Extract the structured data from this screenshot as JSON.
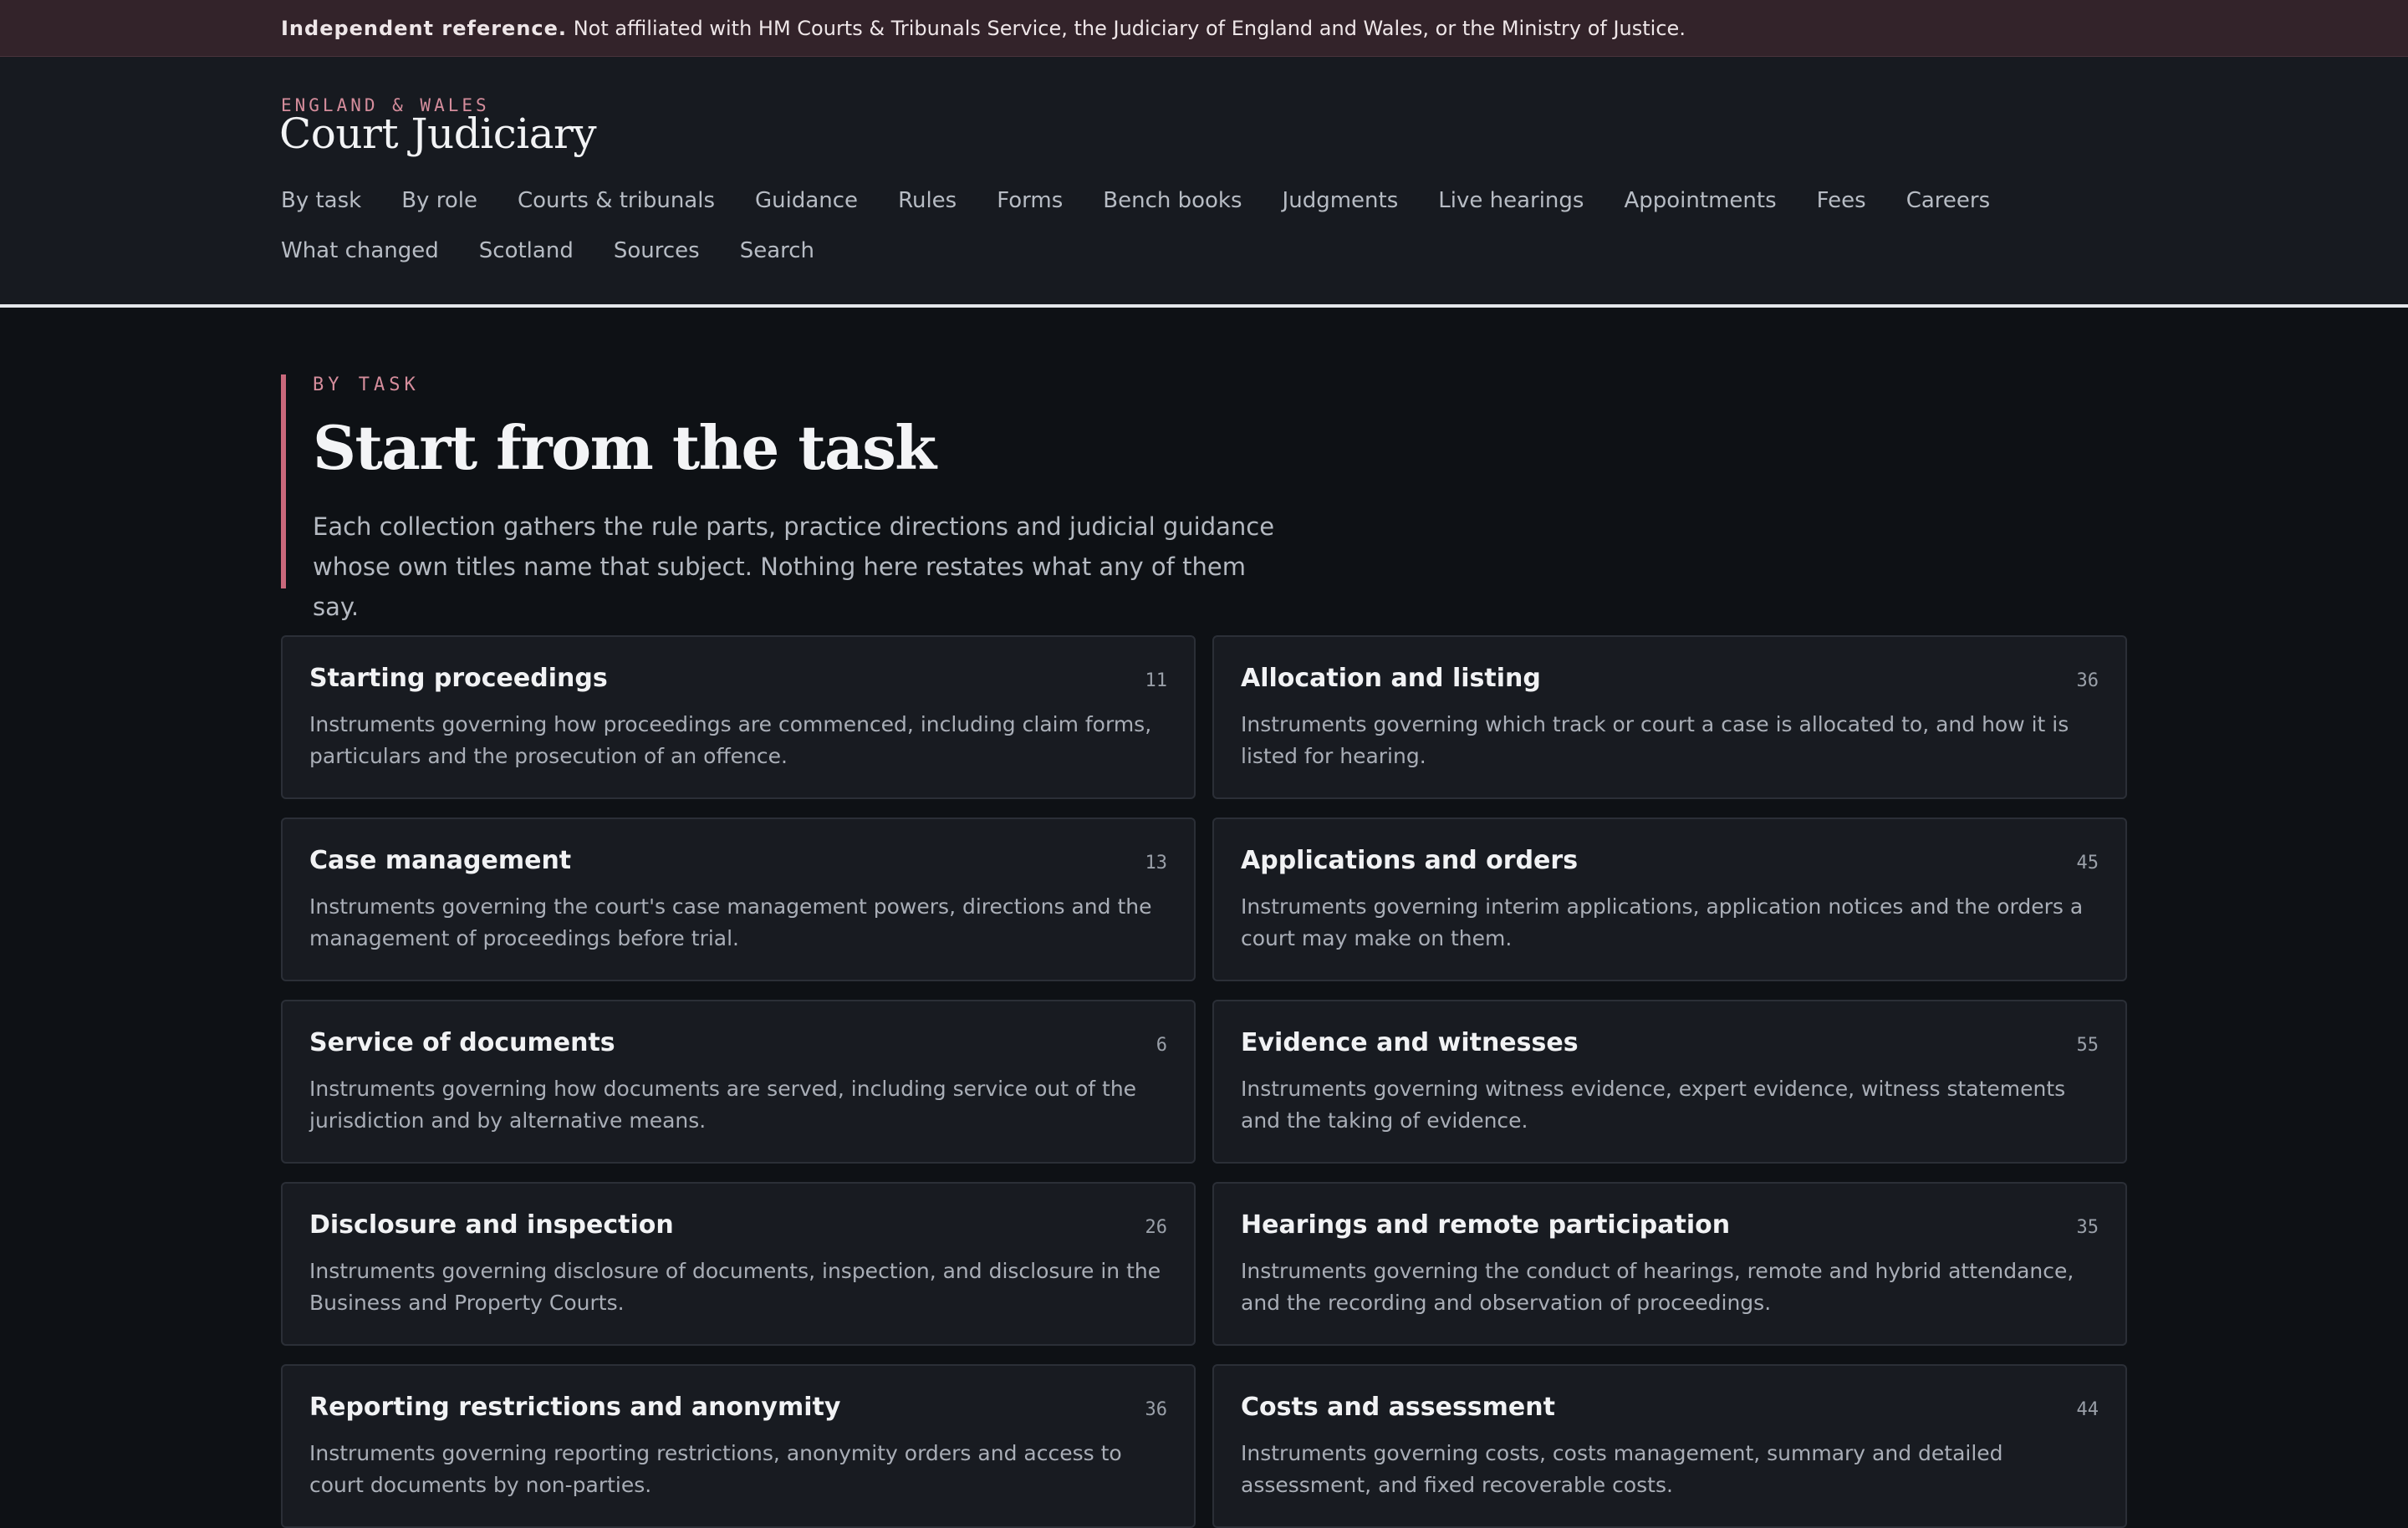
{
  "disclaimer": {
    "strong": "Independent reference.",
    "text": "Not affiliated with HM Courts & Tribunals Service, the Judiciary of England and Wales, or the Ministry of Justice."
  },
  "header": {
    "region": "ENGLAND & WALES",
    "title": "Court Judiciary",
    "nav_row1": [
      "By task",
      "By role",
      "Courts & tribunals",
      "Guidance",
      "Rules",
      "Forms",
      "Bench books",
      "Judgments",
      "Live hearings",
      "Appointments",
      "Fees",
      "Careers"
    ],
    "nav_row2": [
      "What changed",
      "Scotland",
      "Sources",
      "Search"
    ]
  },
  "intro": {
    "eyebrow": "BY TASK",
    "title": "Start from the task",
    "description": "Each collection gathers the rule parts, practice directions and judicial guidance whose own titles name that subject. Nothing here restates what any of them say."
  },
  "cards": [
    {
      "title": "Starting proceedings",
      "count": "11",
      "description": "Instruments governing how proceedings are commenced, including claim forms, particulars and the prosecution of an offence."
    },
    {
      "title": "Allocation and listing",
      "count": "36",
      "description": "Instruments governing which track or court a case is allocated to, and how it is listed for hearing."
    },
    {
      "title": "Case management",
      "count": "13",
      "description": "Instruments governing the court's case management powers, directions and the management of proceedings before trial."
    },
    {
      "title": "Applications and orders",
      "count": "45",
      "description": "Instruments governing interim applications, application notices and the orders a court may make on them."
    },
    {
      "title": "Service of documents",
      "count": "6",
      "description": "Instruments governing how documents are served, including service out of the jurisdiction and by alternative means."
    },
    {
      "title": "Evidence and witnesses",
      "count": "55",
      "description": "Instruments governing witness evidence, expert evidence, witness statements and the taking of evidence."
    },
    {
      "title": "Disclosure and inspection",
      "count": "26",
      "description": "Instruments governing disclosure of documents, inspection, and disclosure in the Business and Property Courts."
    },
    {
      "title": "Hearings and remote participation",
      "count": "35",
      "description": "Instruments governing the conduct of hearings, remote and hybrid attendance, and the recording and observation of proceedings."
    },
    {
      "title": "Reporting restrictions and anonymity",
      "count": "36",
      "description": "Instruments governing reporting restrictions, anonymity orders and access to court documents by non-parties."
    },
    {
      "title": "Costs and assessment",
      "count": "44",
      "description": "Instruments governing costs, costs management, summary and detailed assessment, and fixed recoverable costs."
    }
  ]
}
